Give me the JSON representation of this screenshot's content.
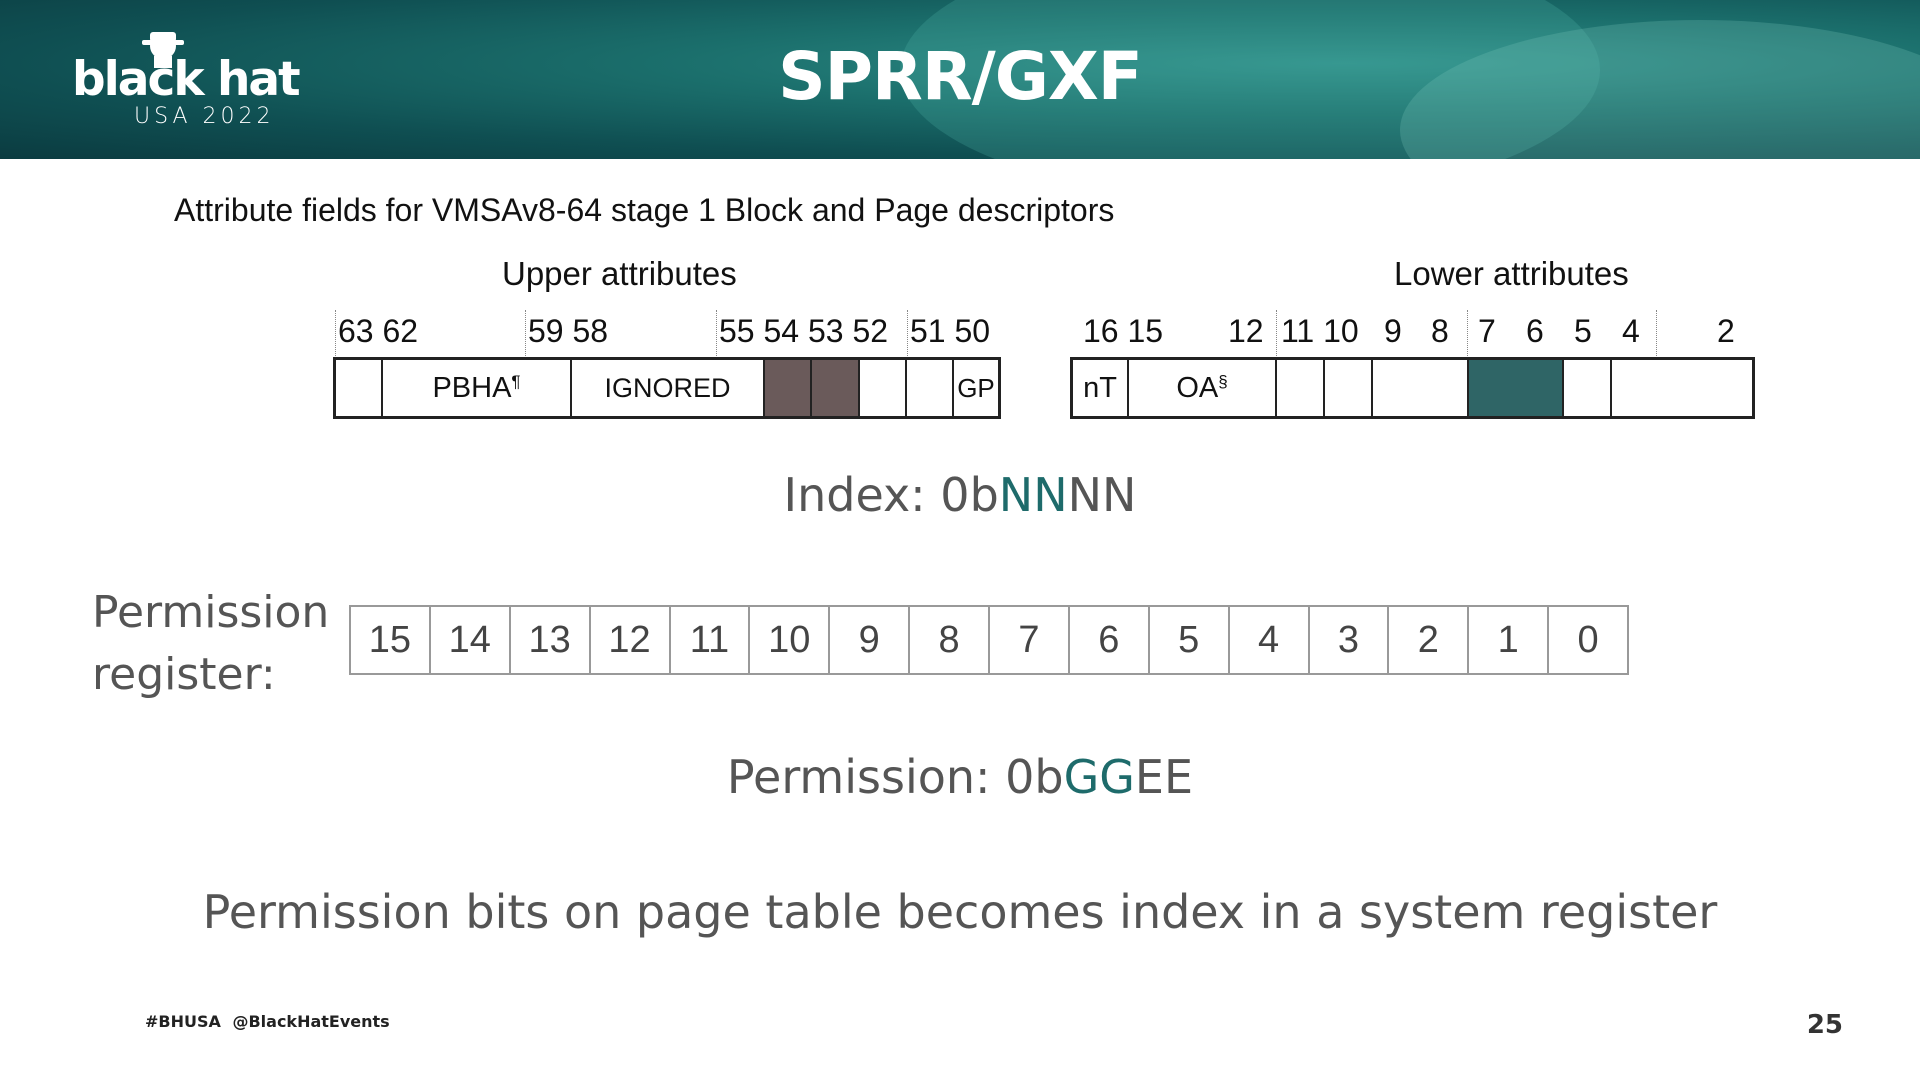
{
  "header": {
    "logo_word": "black hat",
    "logo_sub": "USA 2022",
    "title": "SPRR/GXF",
    "bg_color": "#1b6f6c"
  },
  "diagram": {
    "caption": "Attribute fields for VMSAv8-64 stage 1 Block and Page descriptors",
    "upper_label": "Upper attributes",
    "lower_label": "Lower attributes",
    "upper_bits": [
      "63 62",
      "59 58",
      "55 54 53 52",
      "51 50"
    ],
    "lower_bits": [
      "16 15",
      "12",
      "11 10",
      "9",
      "8",
      "7",
      "6",
      "5",
      "4",
      "2"
    ],
    "upper_fields": [
      "",
      "PBHA",
      "IGNORED",
      "",
      "",
      "",
      "",
      "GP"
    ],
    "upper_field_marks": {
      "pbha": "¶"
    },
    "lower_fields": [
      "nT",
      "OA",
      "",
      "",
      "",
      "",
      "",
      ""
    ],
    "lower_field_marks": {
      "oa": "§"
    },
    "shade_colors": {
      "upper": "#6a5a5a",
      "lower": "#2f6566"
    }
  },
  "index_line": {
    "prefix": "Index: 0b",
    "highlight": "NN",
    "suffix": "NN"
  },
  "permission_register": {
    "label_line1": "Permission",
    "label_line2": "register:",
    "cells": [
      "15",
      "14",
      "13",
      "12",
      "11",
      "10",
      "9",
      "8",
      "7",
      "6",
      "5",
      "4",
      "3",
      "2",
      "1",
      "0"
    ]
  },
  "permission_line": {
    "prefix": "Permission: 0b",
    "highlight": "GG",
    "suffix": "EE"
  },
  "statement": "Permission bits on page table becomes index in a system register",
  "footer": {
    "hashtag": "#BHUSA",
    "handle": "@BlackHatEvents",
    "page_number": "25"
  }
}
